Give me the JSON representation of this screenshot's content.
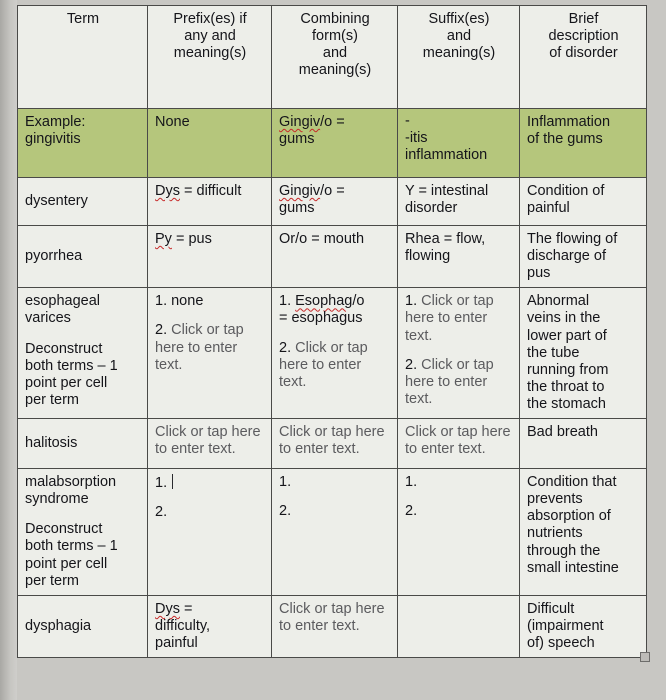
{
  "document": {
    "type": "worksheet-table",
    "columns": [
      "Term",
      "Prefix(es) if any and meaning(s)",
      "Combining form(s) and meaning(s)",
      "Suffix(es) and meaning(s)",
      "Brief description of disorder"
    ],
    "header_lines": [
      [
        "Term"
      ],
      [
        "Prefix(es) if",
        "any and",
        "meaning(s)"
      ],
      [
        "Combining",
        "form(s)",
        "and",
        "meaning(s)"
      ],
      [
        "Suffix(es)",
        "and",
        "meaning(s)"
      ],
      [
        "Brief",
        "description",
        "of disorder"
      ]
    ],
    "placeholder_text": "Click or tap here to enter text.",
    "rows": [
      {
        "id": "example-gingivitis",
        "highlight": true,
        "term": "Example: gingivitis",
        "term_line1": "Example:",
        "term_line2": "gingivitis",
        "prefix": "None",
        "combining_word": "Gingiv",
        "combining_rest": "/o =",
        "combining_line2": "gums",
        "suffix_stray": "-",
        "suffix_line1": "-itis",
        "suffix_line2": "inflammation",
        "description_line1": "Inflammation",
        "description_line2": "of the gums"
      },
      {
        "id": "dysentery",
        "highlight": false,
        "term": "dysentery",
        "prefix_word": "Dys",
        "prefix_rest": " = difficult",
        "combining_word": "Gingiv",
        "combining_rest": "/o =",
        "combining_line2": "gums",
        "suffix_line1": "Y = intestinal",
        "suffix_line2": "disorder",
        "description_line1": "Condition of",
        "description_line2": "painful"
      },
      {
        "id": "pyorrhea",
        "highlight": false,
        "term": "pyorrhea",
        "prefix_word": "Py",
        "prefix_rest": " = pus",
        "combining": "Or/o = mouth",
        "suffix_line1": "Rhea = flow,",
        "suffix_line2": "flowing",
        "description_line1": "The flowing of",
        "description_line2": "discharge of",
        "description_line3": "pus"
      },
      {
        "id": "esophageal-varices",
        "highlight": false,
        "term_line1": "esophageal",
        "term_line2": "varices",
        "term_note1": "Deconstruct",
        "term_note2": "both terms – 1",
        "term_note3": "point per cell",
        "term_note4": "per term",
        "prefix_item1": "1. none",
        "prefix_item2_num": "2. ",
        "prefix_item2_text": "Click or tap here to enter text.",
        "combining_item1_num": "1. ",
        "combining_item1_word": "Esophag",
        "combining_item1_rest": "/o",
        "combining_item1_line2": "= esophagus",
        "combining_item2_num": "2. ",
        "combining_item2_text": "Click or tap here to enter text.",
        "suffix_item1_num": "1. ",
        "suffix_item1_text": "Click or tap here to enter text.",
        "suffix_item2_num": "2. ",
        "suffix_item2_text": "Click or tap here to enter text.",
        "description_line1": "Abnormal",
        "description_line2": "veins in the",
        "description_line3": "lower part of",
        "description_line4": "the tube",
        "description_line5": "running from",
        "description_line6": "the throat to",
        "description_line7": "the stomach"
      },
      {
        "id": "halitosis",
        "highlight": false,
        "term": "halitosis",
        "prefix_text": "Click or tap here to enter text.",
        "combining_text": "Click or tap here to enter text.",
        "suffix_text": "Click or tap here to enter text.",
        "description": "Bad breath"
      },
      {
        "id": "malabsorption-syndrome",
        "highlight": false,
        "term_line1": "malabsorption",
        "term_line2": "syndrome",
        "term_note1": "Deconstruct",
        "term_note2": "both terms – 1",
        "term_note3": "point per cell",
        "term_note4": "per term",
        "prefix_item1": "1.",
        "prefix_item2": "2.",
        "prefix_has_caret": true,
        "combining_item1": "1.",
        "combining_item2": "2.",
        "suffix_item1": "1.",
        "suffix_item2": "2.",
        "description_line1": "Condition that",
        "description_line2": "prevents",
        "description_line3": "absorption of",
        "description_line4": "nutrients",
        "description_line5": "through the",
        "description_line6": "small intestine"
      },
      {
        "id": "dysphagia",
        "highlight": false,
        "term": "dysphagia",
        "prefix_word": "Dys",
        "prefix_rest": " =",
        "prefix_line2": "difficulty,",
        "prefix_line3": "painful",
        "combining_text": "Click or tap here to enter text.",
        "suffix_text": "",
        "description_line1": "Difficult",
        "description_line2": "(impairment",
        "description_line3": "of) speech"
      }
    ],
    "colors": {
      "header_background": "#ccd2dc",
      "example_row_background": "#b5c67c",
      "cell_background": "#edeee9",
      "border": "#4a4a48",
      "text": "#15151a",
      "placeholder_text": "#5b5b5e",
      "spellcheck_underline": "#c62828",
      "page_background": "#c8c7c3"
    }
  }
}
